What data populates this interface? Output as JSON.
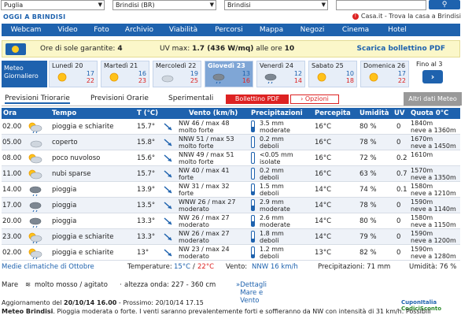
{
  "top": {
    "region": "Puglia",
    "province": "Brindisi (BR)",
    "city": "Brindisi"
  },
  "brand": "OGGI A BRINDISI",
  "casa_link": "Casa.it - Trova la casa a Brindisi",
  "nav": [
    "Webcam",
    "Video",
    "Foto",
    "Archivio",
    "Viabilità",
    "Percorsi",
    "Mappa",
    "Negozi",
    "Cinema",
    "Hotel"
  ],
  "info": {
    "sun_label": "Ore di sole garantite:",
    "sun_value": "4",
    "uv_label": "UV max:",
    "uv_value": "1.7 (436 W/mq)",
    "uv_hour_label": "alle ore",
    "uv_hour": "10",
    "pdf_link": "Scarica bollettino PDF"
  },
  "meteo_tab": "Meteo Giornaliero",
  "days": [
    {
      "name": "Lunedì 20",
      "max": "17",
      "min": "22",
      "icon": "sun-icon"
    },
    {
      "name": "Martedì 21",
      "max": "16",
      "min": "23",
      "icon": "sun-icon"
    },
    {
      "name": "Mercoledì 22",
      "max": "19",
      "min": "25",
      "icon": "cloud-icon"
    },
    {
      "name": "Giovedì 23",
      "max": "13",
      "min": "16",
      "icon": "rain-icon"
    },
    {
      "name": "Venerdì 24",
      "max": "12",
      "min": "14",
      "icon": "rain-icon"
    },
    {
      "name": "Sabato 25",
      "max": "10",
      "min": "18",
      "icon": "sun-icon"
    },
    {
      "name": "Domenica 26",
      "max": "17",
      "min": "22",
      "icon": "sun-icon"
    }
  ],
  "fino": "Fino al 3",
  "tabs": {
    "triorarie": "Previsioni Triorarie",
    "orarie": "Previsioni Orarie",
    "sperimentali": "Sperimentali",
    "bollettino": "Bollettino PDF",
    "opzioni": "Opzioni",
    "altri": "Altri dati Meteo"
  },
  "headers": {
    "ora": "Ora",
    "tempo": "Tempo",
    "temp": "T (°C)",
    "vento": "Vento (km/h)",
    "prec": "Precipitazioni",
    "perc": "Percepita",
    "um": "Umidità",
    "uv": "UV",
    "quota": "Quota 0°C"
  },
  "rows": [
    {
      "ora": "02.00",
      "cond": "pioggia e schiarite",
      "icon": "sun-rain-icon",
      "temp": "15.7°",
      "wind1": "NW 46 / max 48",
      "wind2": "molto forte",
      "prec1": "3.5 mm",
      "prec2": "moderate",
      "fill": 0.5,
      "perc": "16°C",
      "um": "80 %",
      "uv": "0",
      "q1": "1840m",
      "q2": "neve a 1360m"
    },
    {
      "ora": "05.00",
      "cond": "coperto",
      "icon": "cloud-icon",
      "temp": "15.8°",
      "wind1": "NNW 51 / max 53",
      "wind2": "molto forte",
      "prec1": "0.2 mm",
      "prec2": "deboli",
      "fill": 0.0,
      "perc": "16°C",
      "um": "78 %",
      "uv": "0",
      "q1": "1670m",
      "q2": "neve a 1450m"
    },
    {
      "ora": "08.00",
      "cond": "poco nuvoloso",
      "icon": "sun-cloud-icon",
      "temp": "15.6°",
      "wind1": "NNW 49 / max 51",
      "wind2": "molto forte",
      "prec1": "<0.05 mm",
      "prec2": "isolate",
      "fill": 0.0,
      "perc": "16°C",
      "um": "72 %",
      "uv": "0.2",
      "q1": "1610m",
      "q2": ""
    },
    {
      "ora": "11.00",
      "cond": "nubi sparse",
      "icon": "sun-cloud-icon",
      "temp": "15.7°",
      "wind1": "NW 40 / max 41",
      "wind2": "forte",
      "prec1": "0.2 mm",
      "prec2": "deboli",
      "fill": 0.0,
      "perc": "16°C",
      "um": "63 %",
      "uv": "0.7",
      "q1": "1570m",
      "q2": "neve a 1350m"
    },
    {
      "ora": "14.00",
      "cond": "pioggia",
      "icon": "rain-icon",
      "temp": "13.9°",
      "wind1": "NW 31 / max 32",
      "wind2": "forte",
      "prec1": "1.5 mm",
      "prec2": "deboli",
      "fill": 0.3,
      "perc": "14°C",
      "um": "74 %",
      "uv": "0.1",
      "q1": "1580m",
      "q2": "neve a 1210m"
    },
    {
      "ora": "17.00",
      "cond": "pioggia",
      "icon": "rain-icon",
      "temp": "13.5°",
      "wind1": "WNW 26 / max 27",
      "wind2": "moderato",
      "prec1": "2.9 mm",
      "prec2": "moderate",
      "fill": 0.5,
      "perc": "14°C",
      "um": "78 %",
      "uv": "0",
      "q1": "1590m",
      "q2": "neve a 1140m"
    },
    {
      "ora": "20.00",
      "cond": "pioggia",
      "icon": "rain-icon",
      "temp": "13.3°",
      "wind1": "NW 26 / max 27",
      "wind2": "moderato",
      "prec1": "2.6 mm",
      "prec2": "moderate",
      "fill": 0.5,
      "perc": "14°C",
      "um": "80 %",
      "uv": "0",
      "q1": "1580m",
      "q2": "neve a 1150m"
    },
    {
      "ora": "23.00",
      "cond": "pioggia e schiarite",
      "icon": "sun-rain-icon",
      "temp": "13.3°",
      "wind1": "NW 26 / max 27",
      "wind2": "moderato",
      "prec1": "1.8 mm",
      "prec2": "deboli",
      "fill": 0.3,
      "perc": "14°C",
      "um": "79 %",
      "uv": "0",
      "q1": "1590m",
      "q2": "neve a 1200m"
    },
    {
      "ora": "02.00",
      "cond": "pioggia e schiarite",
      "icon": "sun-rain-icon",
      "temp": "13°",
      "wind1": "NW 23 / max 24",
      "wind2": "moderato",
      "prec1": "1.2 mm",
      "prec2": "deboli",
      "fill": 0.3,
      "perc": "13°C",
      "um": "82 %",
      "uv": "0",
      "q1": "1590m",
      "q2": "neve a 1280m"
    }
  ],
  "medie": {
    "link": "Medie climatiche di Ottobre",
    "temp_label": "Temperature:",
    "tmin": "15°C",
    "tmax": "22°C",
    "wind_label": "Vento:",
    "wind_value": "NNW 16 km/h",
    "prec_label": "Precipitazioni: 71 mm",
    "um_label": "Umidità: 76 %"
  },
  "mare": {
    "label": "Mare",
    "value": "molto mosso / agitato",
    "wave": "altezza onda: 227 - 360 cm",
    "link": "Dettagli Mare e Vento"
  },
  "agg": {
    "prefix": "Aggiornamento del",
    "date": "20/10/14 16.00",
    "next": "- Prossimo: 20/10/14 17.15"
  },
  "desc": {
    "bold": "Meteo Brindisi",
    "text": ". Pioggia moderata o forte. I venti saranno prevalentemente forti e soffieranno da NW con intensità di 31 km/h. Possibili"
  },
  "coupon": {
    "a": "CuponItalia",
    "b": "CodiciSconto"
  },
  "colors": {
    "blue": "#1e62ae",
    "red": "#dd2222",
    "yellow_bg": "#fbf7c9"
  }
}
